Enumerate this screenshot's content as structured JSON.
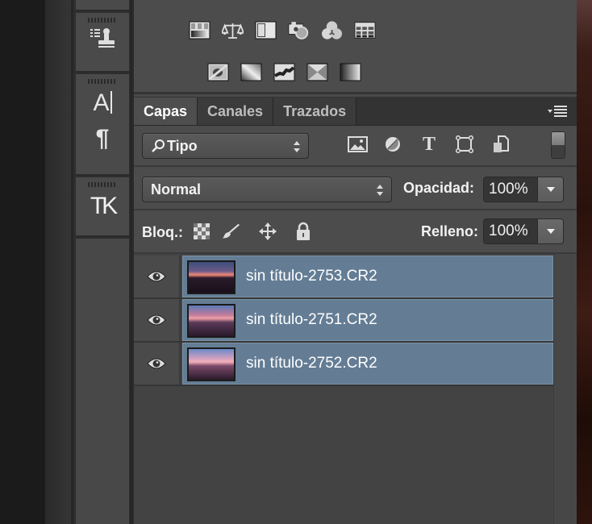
{
  "dock": {
    "groups": [
      {
        "items": [
          {
            "icon": "clone-source-icon",
            "label": "Clone Source"
          }
        ]
      },
      {
        "items": [
          {
            "icon": "character-icon",
            "label": "Character"
          },
          {
            "icon": "paragraph-icon",
            "label": "Paragraph"
          }
        ]
      },
      {
        "items": [
          {
            "icon": "glyphs-tk-icon",
            "label": "TK"
          }
        ]
      }
    ],
    "tk_label": "TK",
    "paragraph_glyph": "¶",
    "char_label": "A"
  },
  "adjustments": {
    "row1": [
      "levels-icon",
      "balance-icon",
      "exposure-icon",
      "photo-filter-icon",
      "channel-mixer-icon",
      "color-lookup-icon"
    ],
    "row2": [
      "invert-icon",
      "posterize-icon",
      "threshold-icon",
      "selective-color-icon",
      "gradient-map-icon"
    ]
  },
  "layers_panel": {
    "tabs": [
      {
        "label": "Capas",
        "active": true
      },
      {
        "label": "Canales",
        "active": false
      },
      {
        "label": "Trazados",
        "active": false
      }
    ],
    "filter": {
      "value": "Tipo"
    },
    "filter_icons": [
      "pixel-layer-filter-icon",
      "adjustment-filter-icon",
      "type-filter-icon",
      "shape-filter-icon",
      "smart-object-filter-icon"
    ],
    "blend_mode": "Normal",
    "opacity_label": "Opacidad:",
    "opacity_value": "100%",
    "lock_label": "Bloq.:",
    "fill_label": "Relleno:",
    "fill_value": "100%",
    "layers": [
      {
        "name": "sin título-2753.CR2",
        "visible": true,
        "selected": true
      },
      {
        "name": "sin título-2751.CR2",
        "visible": true,
        "selected": true
      },
      {
        "name": "sin título-2752.CR2",
        "visible": true,
        "selected": true
      }
    ]
  },
  "colors": {
    "selection": "#647d95",
    "panel": "#4a4a4a"
  }
}
